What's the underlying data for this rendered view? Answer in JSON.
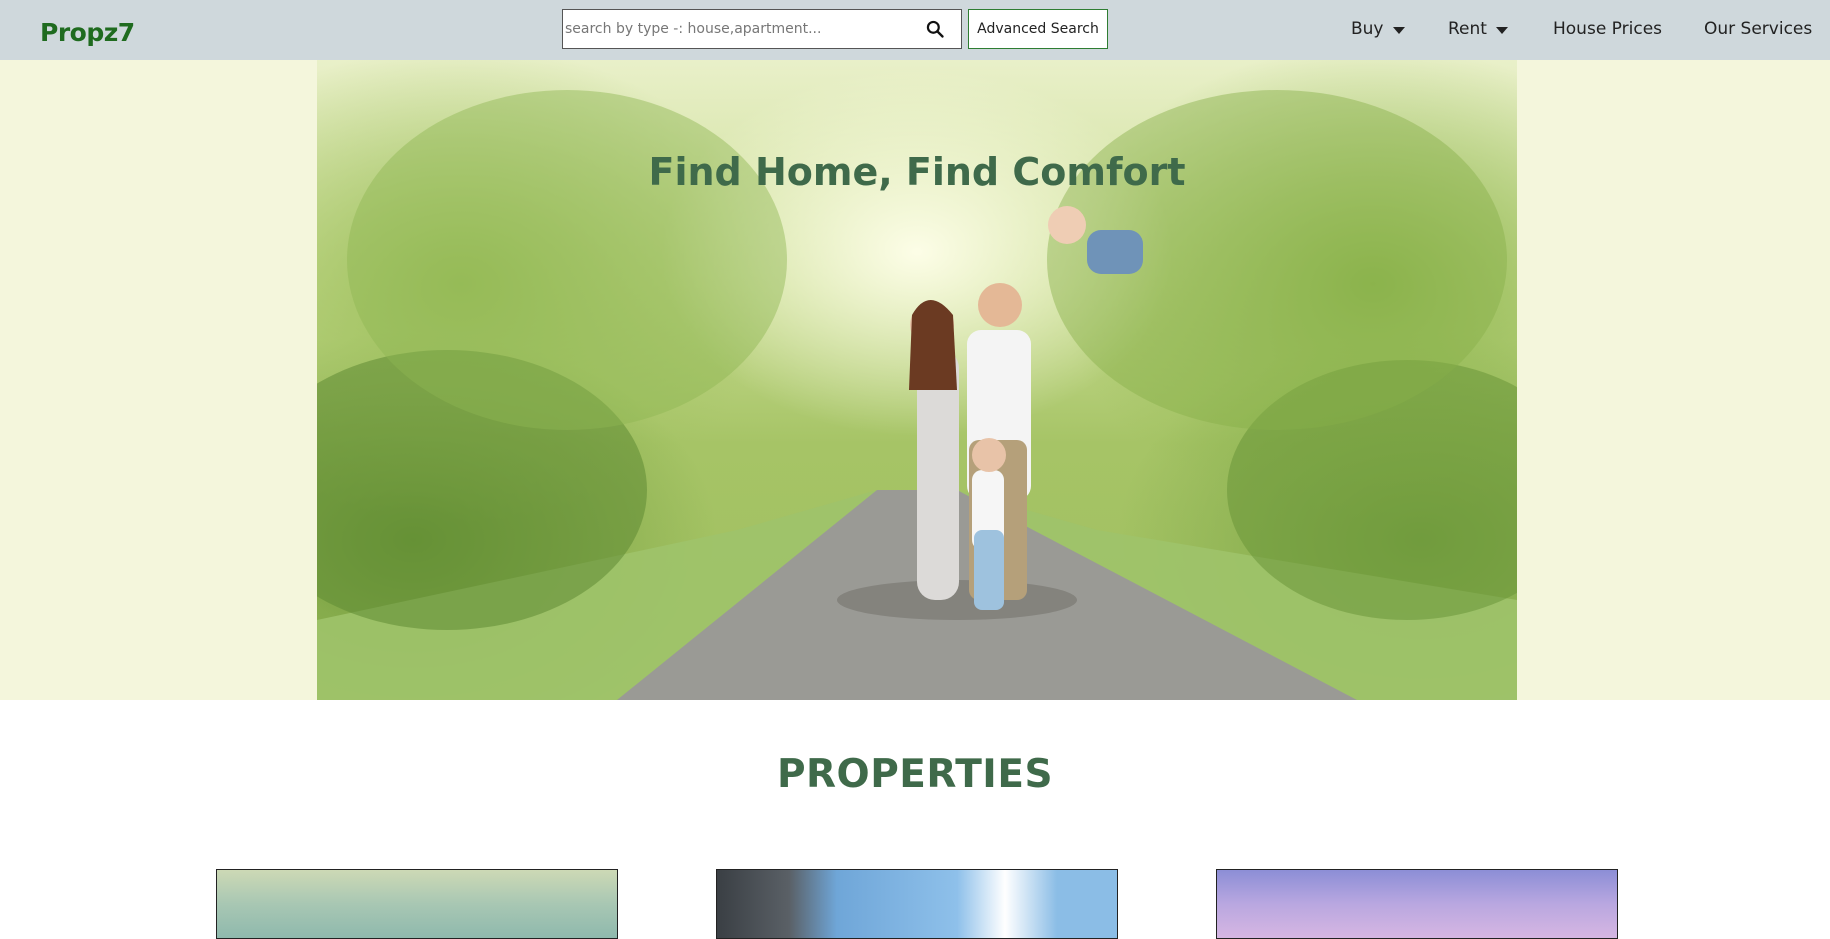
{
  "header": {
    "logo": "Propz7",
    "search": {
      "placeholder": "search by type -: house,apartment..."
    },
    "advanced_search_label": "Advanced Search",
    "nav": {
      "buy": "Buy",
      "rent": "Rent",
      "house_prices": "House Prices",
      "our_services": "Our Services"
    }
  },
  "hero": {
    "title": "Find Home, Find Comfort"
  },
  "properties": {
    "title": "PROPERTIES"
  },
  "colors": {
    "navbar_bg": "#cfd8dc",
    "logo": "#1f6b1f",
    "heading": "#3f6a4a",
    "hero_band": "#f4f6dc",
    "button_border": "#2e7d32"
  },
  "icons": [
    "search-icon",
    "caret-down-icon"
  ]
}
